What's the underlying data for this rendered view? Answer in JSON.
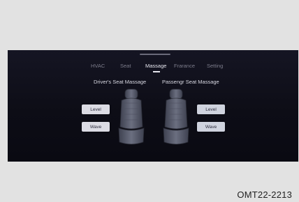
{
  "tabs": [
    "HVAC",
    "Seat",
    "Massage",
    "Frarance",
    "Setting"
  ],
  "active_tab": "Massage",
  "driver": {
    "title": "Driver's Seat Massage",
    "level_label": "Level",
    "wave_label": "Wave"
  },
  "passenger": {
    "title": "Passengr Seat Massage",
    "level_label": "Level",
    "wave_label": "Wave"
  },
  "caption": "OMT22-2213",
  "colors": {
    "screen_bg": "#12121d",
    "tab_active": "#e6e6ee",
    "tab_inactive": "#7d7d8c",
    "button_bg": "#dcdce4",
    "seat": "#5a5e6e"
  }
}
